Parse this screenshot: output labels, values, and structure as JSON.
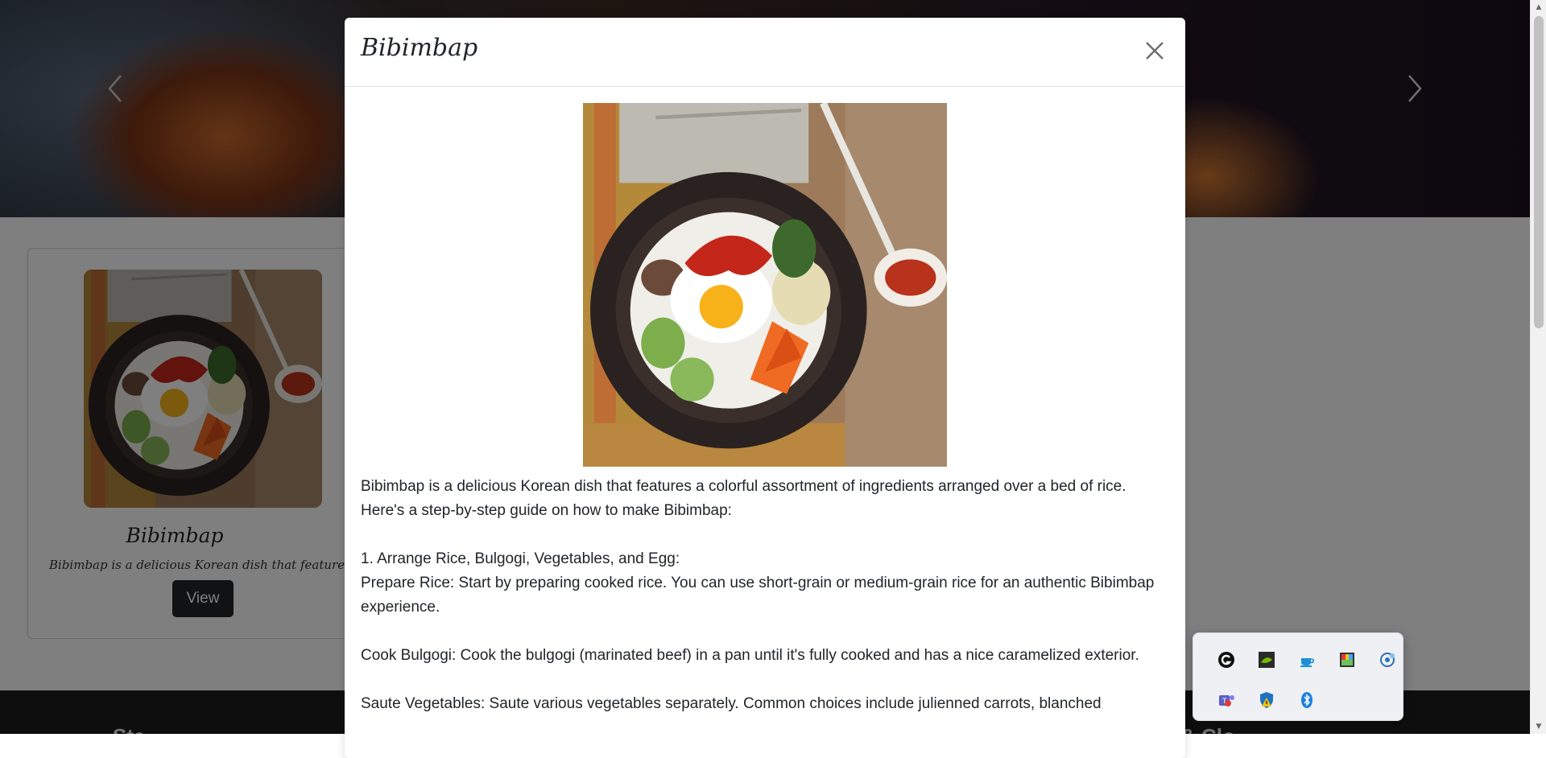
{
  "carousel": {
    "prev_symbol": "‹",
    "next_symbol": "›"
  },
  "card": {
    "title": "Bibimbap",
    "text": "Bibimbap is a delicious Korean dish that features a colo",
    "button_label": "View"
  },
  "footer": {
    "left_fragment": "Sta",
    "right_fragment": "& Clo"
  },
  "modal": {
    "title": "Bibimbap",
    "close_symbol": "×",
    "paragraphs": [
      "Bibimbap is a delicious Korean dish that features a colorful assortment of ingredients arranged over a bed of rice. Here's a step-by-step guide on how to make Bibimbap:",
      "1. Arrange Rice, Bulgogi, Vegetables, and Egg:\nPrepare Rice: Start by preparing cooked rice. You can use short-grain or medium-grain rice for an authentic Bibimbap experience.",
      "Cook Bulgogi: Cook the bulgogi (marinated beef) in a pan until it's fully cooked and has a nice caramelized exterior.",
      "Saute Vegetables: Saute various vegetables separately. Common choices include julienned carrots, blanched"
    ]
  },
  "tray": {
    "icons": [
      "g-hub-icon",
      "nvidia-icon",
      "java-update-icon",
      "color-app-icon",
      "network-settings-icon",
      "teams-icon",
      "windows-security-icon",
      "bluetooth-icon"
    ]
  },
  "colors": {
    "button_dark": "#212529",
    "backdrop": "rgba(0,0,0,0.5)",
    "footer": "#1c1c1c"
  }
}
